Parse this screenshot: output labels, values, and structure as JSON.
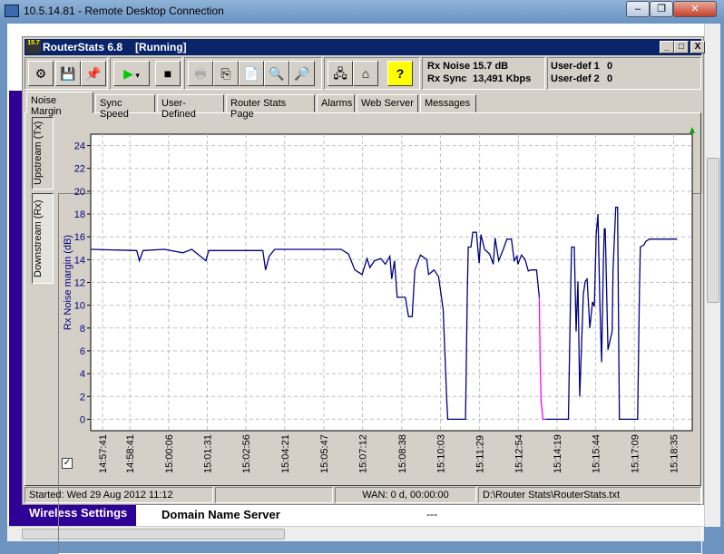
{
  "rdp": {
    "title": "10.5.14.81 - Remote Desktop Connection",
    "minimize": "‒",
    "restore": "❐",
    "close": "✕"
  },
  "background_page": {
    "sidebar_item": "Wireless Settings",
    "row_label": "Domain Name Server",
    "row_value": "---"
  },
  "app": {
    "title": "RouterStats 6.8",
    "state": "[Running]",
    "icon_text": "15.7",
    "minimize": "_",
    "maximize": "□",
    "close": "X"
  },
  "toolbar": {
    "buttons": [
      {
        "name": "settings-button",
        "icon": "gear-icon",
        "glyph": "⚙"
      },
      {
        "name": "save-button",
        "icon": "floppy-icon",
        "glyph": "💾"
      },
      {
        "name": "pin-button",
        "icon": "pin-icon",
        "glyph": "📌"
      },
      {
        "name": "play-button",
        "icon": "play-icon",
        "glyph": "▶"
      },
      {
        "name": "stop-button",
        "icon": "stop-icon",
        "glyph": "■"
      },
      {
        "name": "print-button",
        "icon": "printer-icon",
        "glyph": "🖶"
      },
      {
        "name": "copy-button",
        "icon": "copy-icon",
        "glyph": "⎘"
      },
      {
        "name": "export-button",
        "icon": "export-icon",
        "glyph": "📄"
      },
      {
        "name": "preview-graph-button",
        "icon": "graph-preview-icon",
        "glyph": "🔍"
      },
      {
        "name": "preview-report-button",
        "icon": "report-preview-icon",
        "glyph": "🔎"
      },
      {
        "name": "router-page-button",
        "icon": "router-icon",
        "glyph": "🖧"
      },
      {
        "name": "home-button",
        "icon": "home-icon",
        "glyph": "⌂"
      },
      {
        "name": "help-button",
        "icon": "help-icon",
        "glyph": "?"
      }
    ]
  },
  "info": {
    "rx_noise_label": "Rx Noise",
    "rx_noise_value": "15.7 dB",
    "rx_sync_label": "Rx Sync",
    "rx_sync_value": "13,491 Kbps",
    "user_def1_label": "User-def 1",
    "user_def1_value": "0",
    "user_def2_label": "User-def 2",
    "user_def2_value": "0"
  },
  "tabs": [
    "Noise Margin",
    "Sync Speed",
    "User-Defined",
    "Router Stats Page",
    "Alarms",
    "Web Server",
    "Messages"
  ],
  "active_tab": "Noise Margin",
  "side_tabs": [
    "Upstream (Tx)",
    "Downstream (Rx)"
  ],
  "active_side_tab": "Downstream (Rx)",
  "checkbox_checked": true,
  "status": {
    "started": "Started: Wed 29 Aug 2012   11:12",
    "empty": "",
    "wan": "WAN: 0 d, 00:00:00",
    "file": "D:\\Router Stats\\RouterStats.txt"
  },
  "chart_data": {
    "type": "line",
    "title": "",
    "xlabel": "",
    "ylabel": "Rx Noise margin (dB)",
    "ylim": [
      -1,
      25
    ],
    "xlim": [
      "14:57:15",
      "15:19:16"
    ],
    "yticks": [
      0,
      2,
      4,
      6,
      8,
      10,
      12,
      14,
      16,
      18,
      20,
      22,
      24
    ],
    "xticks": [
      "14:57:41",
      "14:58:41",
      "15:00:06",
      "15:01:31",
      "15:02:56",
      "15:04:21",
      "15:05:47",
      "15:07:12",
      "15:08:38",
      "15:10:03",
      "15:11:29",
      "15:12:54",
      "15:14:19",
      "15:15:44",
      "15:17:09",
      "15:18:35"
    ],
    "grid": true,
    "line_color": "#000080",
    "highlight_color": "#ff00ff",
    "indicator_color": "#00a000",
    "series": [
      {
        "points": [
          [
            "14:57:15",
            14.9
          ],
          [
            "14:58:56",
            14.8
          ],
          [
            "14:59:02",
            13.9
          ],
          [
            "14:59:10",
            14.8
          ],
          [
            "14:59:57",
            14.9
          ],
          [
            "15:00:37",
            14.6
          ],
          [
            "15:00:57",
            14.9
          ],
          [
            "15:01:28",
            13.9
          ],
          [
            "15:01:34",
            14.8
          ],
          [
            "15:02:38",
            14.8
          ],
          [
            "15:03:33",
            14.8
          ],
          [
            "15:03:39",
            13.1
          ],
          [
            "15:03:47",
            14.3
          ],
          [
            "15:03:59",
            14.9
          ],
          [
            "15:05:20",
            14.9
          ],
          [
            "15:06:25",
            14.9
          ],
          [
            "15:06:37",
            14.6
          ],
          [
            "15:06:41",
            14.5
          ],
          [
            "15:06:55",
            13.1
          ],
          [
            "15:07:11",
            12.7
          ],
          [
            "15:07:22",
            14.1
          ],
          [
            "15:07:28",
            13.3
          ],
          [
            "15:07:38",
            13.9
          ],
          [
            "15:07:52",
            14.1
          ],
          [
            "15:08:02",
            13.6
          ],
          [
            "15:08:12",
            14.3
          ],
          [
            "15:08:16",
            12.3
          ],
          [
            "15:08:22",
            13.9
          ],
          [
            "15:08:28",
            10.7
          ],
          [
            "15:08:46",
            10.7
          ],
          [
            "15:08:53",
            9.0
          ],
          [
            "15:09:01",
            9.0
          ],
          [
            "15:09:07",
            13.1
          ],
          [
            "15:09:19",
            14.4
          ],
          [
            "15:09:33",
            14.0
          ],
          [
            "15:09:37",
            12.7
          ],
          [
            "15:09:49",
            13.1
          ],
          [
            "15:09:59",
            12.5
          ],
          [
            "15:10:09",
            9.6
          ],
          [
            "15:10:17",
            1.5
          ],
          [
            "15:10:19",
            0
          ],
          [
            "15:10:58",
            0
          ],
          [
            "15:11:02",
            11.3
          ],
          [
            "15:11:04",
            15.1
          ],
          [
            "15:11:10",
            15.1
          ],
          [
            "15:11:14",
            16.4
          ],
          [
            "15:11:22",
            16.4
          ],
          [
            "15:11:28",
            13.7
          ],
          [
            "15:11:32",
            16.2
          ],
          [
            "15:11:40",
            14.9
          ],
          [
            "15:11:51",
            14.5
          ],
          [
            "15:11:59",
            13.6
          ],
          [
            "15:12:03",
            15.9
          ],
          [
            "15:12:11",
            13.9
          ],
          [
            "15:12:21",
            14.9
          ],
          [
            "15:12:29",
            15.8
          ],
          [
            "15:12:39",
            15.8
          ],
          [
            "15:12:45",
            13.9
          ],
          [
            "15:12:51",
            14.3
          ],
          [
            "15:12:53",
            13.6
          ],
          [
            "15:13:01",
            14.4
          ],
          [
            "15:13:09",
            14.0
          ],
          [
            "15:13:16",
            13.0
          ],
          [
            "15:13:22",
            13.1
          ],
          [
            "15:13:34",
            13.1
          ],
          [
            "15:13:40",
            10.7
          ]
        ]
      },
      {
        "highlight": true,
        "points": [
          [
            "15:13:40",
            10.7
          ],
          [
            "15:13:42",
            5.0
          ],
          [
            "15:13:44",
            1.6
          ],
          [
            "15:13:48",
            0
          ],
          [
            "15:13:54",
            0
          ]
        ]
      },
      {
        "points": [
          [
            "15:13:54",
            0
          ],
          [
            "15:14:44",
            0
          ],
          [
            "15:14:49",
            11.4
          ],
          [
            "15:14:51",
            15.1
          ],
          [
            "15:14:57",
            15.1
          ],
          [
            "15:15:01",
            7.7
          ],
          [
            "15:15:05",
            12.1
          ],
          [
            "15:15:09",
            2.0
          ],
          [
            "15:15:17",
            11.0
          ],
          [
            "15:15:21",
            12.1
          ],
          [
            "15:15:25",
            12.3
          ],
          [
            "15:15:31",
            8.0
          ],
          [
            "15:15:37",
            10.3
          ],
          [
            "15:15:41",
            9.9
          ],
          [
            "15:15:45",
            16.2
          ],
          [
            "15:15:49",
            18.0
          ],
          [
            "15:15:53",
            10.4
          ],
          [
            "15:15:57",
            5.0
          ],
          [
            "15:16:01",
            14.0
          ],
          [
            "15:16:03",
            16.7
          ],
          [
            "15:16:05",
            16.7
          ],
          [
            "15:16:11",
            6.1
          ],
          [
            "15:16:20",
            7.7
          ],
          [
            "15:16:22",
            13.1
          ],
          [
            "15:16:28",
            18.6
          ],
          [
            "15:16:32",
            18.6
          ],
          [
            "15:16:34",
            9.1
          ],
          [
            "15:16:36",
            0
          ],
          [
            "15:17:16",
            0
          ],
          [
            "15:17:20",
            11.3
          ],
          [
            "15:17:22",
            15.1
          ],
          [
            "15:17:30",
            15.3
          ],
          [
            "15:17:34",
            15.6
          ],
          [
            "15:17:42",
            15.8
          ],
          [
            "15:18:43",
            15.8
          ]
        ]
      }
    ]
  }
}
